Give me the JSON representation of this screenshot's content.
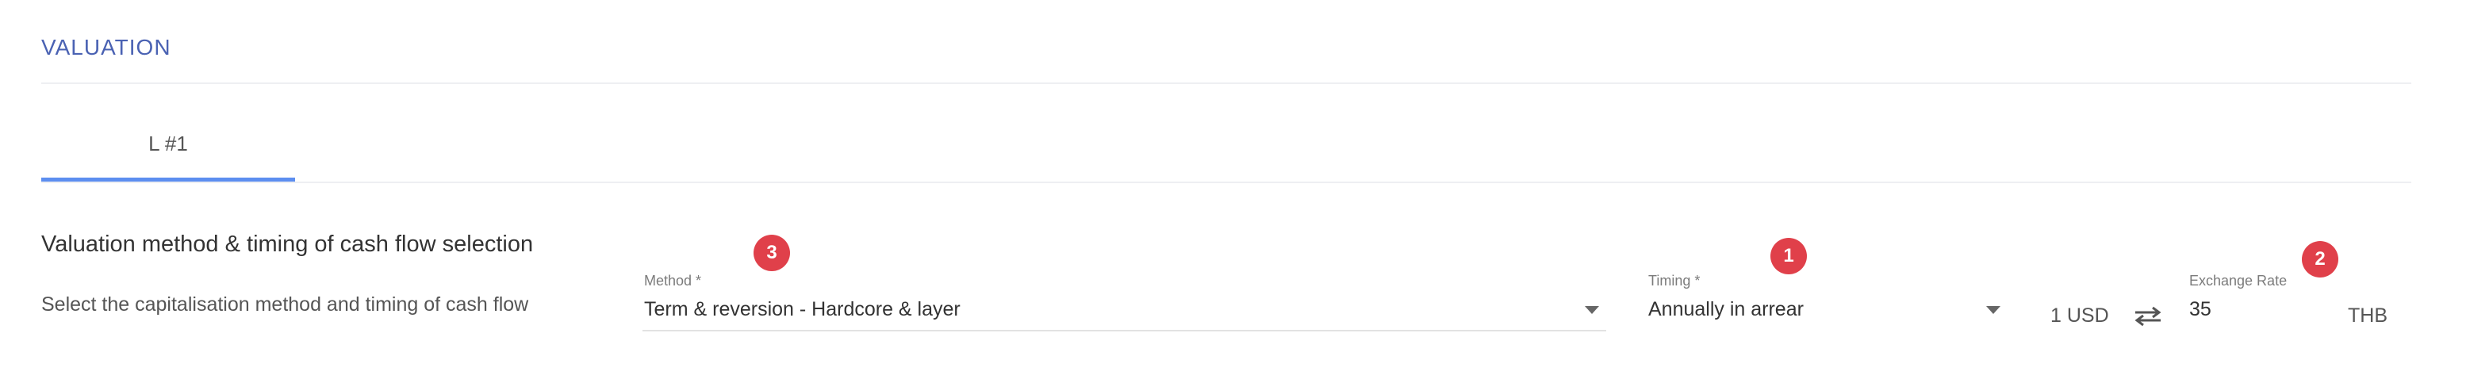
{
  "section": {
    "title": "VALUATION"
  },
  "tabs": [
    {
      "label": "L #1"
    }
  ],
  "valuation_method": {
    "heading": "Valuation method & timing of cash flow selection",
    "description": "Select the capitalisation method and timing of cash flow"
  },
  "method_field": {
    "label": "Method *",
    "value": "Term & reversion - Hardcore & layer",
    "icon": "chevron-down-icon"
  },
  "timing_field": {
    "label": "Timing *",
    "value": "Annually in arrear",
    "icon": "chevron-down-icon"
  },
  "exchange": {
    "from_unit": "1 USD",
    "icon": "swap-arrows-icon",
    "rate_label": "Exchange Rate",
    "rate_value": "35",
    "to_unit": "THB"
  },
  "badges": [
    {
      "number": "1",
      "color": "#e0404a"
    },
    {
      "number": "2",
      "color": "#e0404a"
    },
    {
      "number": "3",
      "color": "#e0404a"
    }
  ]
}
